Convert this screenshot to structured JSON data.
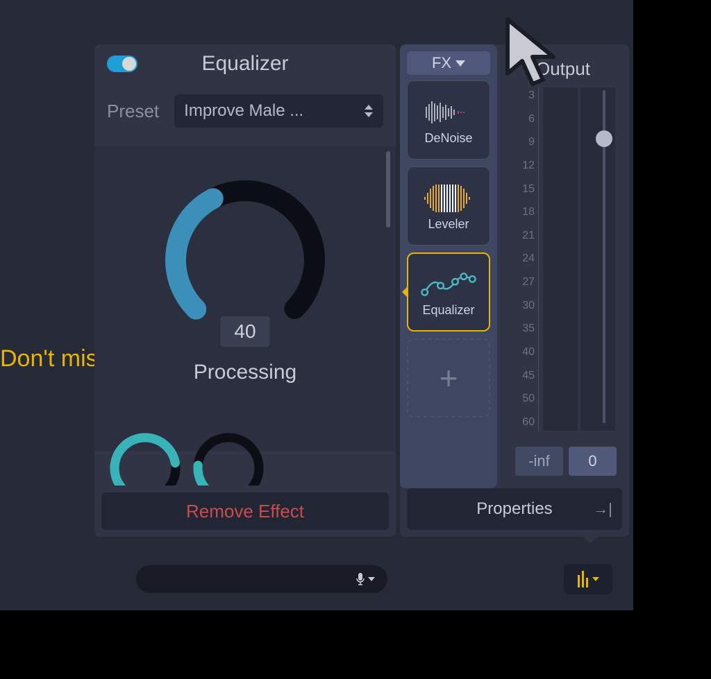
{
  "caption_behind": "Don't mis",
  "eq": {
    "title": "Equalizer",
    "preset_label": "Preset",
    "preset_value": "Improve Male ...",
    "dial_value": "40",
    "dial_label": "Processing",
    "remove_label": "Remove Effect"
  },
  "fx": {
    "dropdown_label": "FX",
    "items": [
      {
        "label": "DeNoise",
        "selected": false
      },
      {
        "label": "Leveler",
        "selected": false
      },
      {
        "label": "Equalizer",
        "selected": true
      }
    ]
  },
  "output": {
    "title": "Output",
    "ticks": [
      "3",
      "6",
      "9",
      "12",
      "15",
      "18",
      "21",
      "24",
      "27",
      "30",
      "35",
      "40",
      "45",
      "50",
      "60"
    ],
    "readout_peak": "-inf",
    "readout_gain": "0"
  },
  "properties_label": "Properties"
}
